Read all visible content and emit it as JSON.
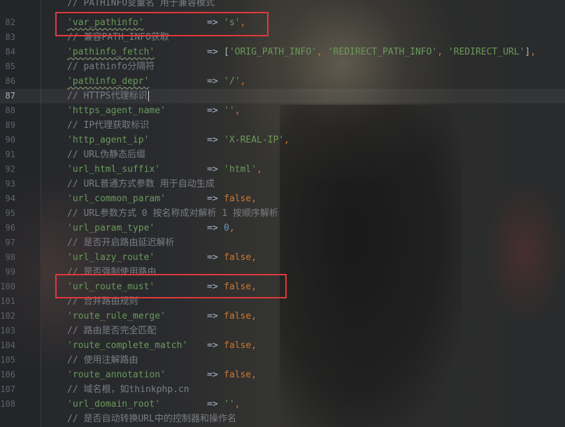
{
  "editor": {
    "current_line": "87",
    "lines": [
      {
        "num": "82",
        "key": "'var_pathinfo'",
        "arrow": "=>",
        "value": "'s'",
        "tail": ","
      },
      {
        "num": "83",
        "comment": "// 兼容PATH_INFO获取"
      },
      {
        "num": "84",
        "key": "'pathinfo_fetch'",
        "arrow": "=>",
        "value": "['ORIG_PATH_INFO', 'REDIRECT_PATH_INFO', 'REDIRECT_URL']",
        "tail": ","
      },
      {
        "num": "85",
        "comment": "// pathinfo分隔符"
      },
      {
        "num": "86",
        "key": "'pathinfo_depr'",
        "arrow": "=>",
        "value": "'/'",
        "tail": ","
      },
      {
        "num": "87",
        "comment": "// HTTPS代理标识"
      },
      {
        "num": "88",
        "key": "'https_agent_name'",
        "arrow": "=>",
        "value": "''",
        "tail": ","
      },
      {
        "num": "89",
        "comment": "// IP代理获取标识"
      },
      {
        "num": "90",
        "key": "'http_agent_ip'",
        "arrow": "=>",
        "value": "'X-REAL-IP'",
        "tail": ","
      },
      {
        "num": "91",
        "comment": "// URL伪静态后缀"
      },
      {
        "num": "92",
        "key": "'url_html_suffix'",
        "arrow": "=>",
        "value": "'html'",
        "tail": ","
      },
      {
        "num": "93",
        "comment": "// URL普通方式参数 用于自动生成"
      },
      {
        "num": "94",
        "key": "'url_common_param'",
        "arrow": "=>",
        "value": "false",
        "tail": ","
      },
      {
        "num": "95",
        "comment": "// URL参数方式 0 按名称成对解析 1 按顺序解析"
      },
      {
        "num": "96",
        "key": "'url_param_type'",
        "arrow": "=>",
        "value": "0",
        "tail": ","
      },
      {
        "num": "97",
        "comment": "// 是否开启路由延迟解析"
      },
      {
        "num": "98",
        "key": "'url_lazy_route'",
        "arrow": "=>",
        "value": "false",
        "tail": ","
      },
      {
        "num": "99",
        "comment": "// 是否强制使用路由"
      },
      {
        "num": "100",
        "key": "'url_route_must'",
        "arrow": "=>",
        "value": "false",
        "tail": ","
      },
      {
        "num": "101",
        "comment": "// 合并路由规则"
      },
      {
        "num": "102",
        "key": "'route_rule_merge'",
        "arrow": "=>",
        "value": "false",
        "tail": ","
      },
      {
        "num": "103",
        "comment": "// 路由是否完全匹配"
      },
      {
        "num": "104",
        "key": "'route_complete_match'",
        "arrow": "=>",
        "value": "false",
        "tail": ","
      },
      {
        "num": "105",
        "comment": "// 使用注解路由"
      },
      {
        "num": "106",
        "key": "'route_annotation'",
        "arrow": "=>",
        "value": "false",
        "tail": ","
      },
      {
        "num": "107",
        "comment": "// 域名根，如thinkphp.cn"
      },
      {
        "num": "108",
        "key": "'url_domain_root'",
        "arrow": "=>",
        "value": "''",
        "tail": ","
      },
      {
        "num": "",
        "comment": "// 是否自动转换URL中的控制器和操作名"
      }
    ],
    "top_partial_comment": "// PATHINFO变量名 用于兼容模式"
  },
  "colors": {
    "string": "#6a9a5b",
    "keyword": "#cc7832",
    "number": "#6897bb",
    "comment": "#7a7e85",
    "highlight_box": "#e0393c"
  }
}
